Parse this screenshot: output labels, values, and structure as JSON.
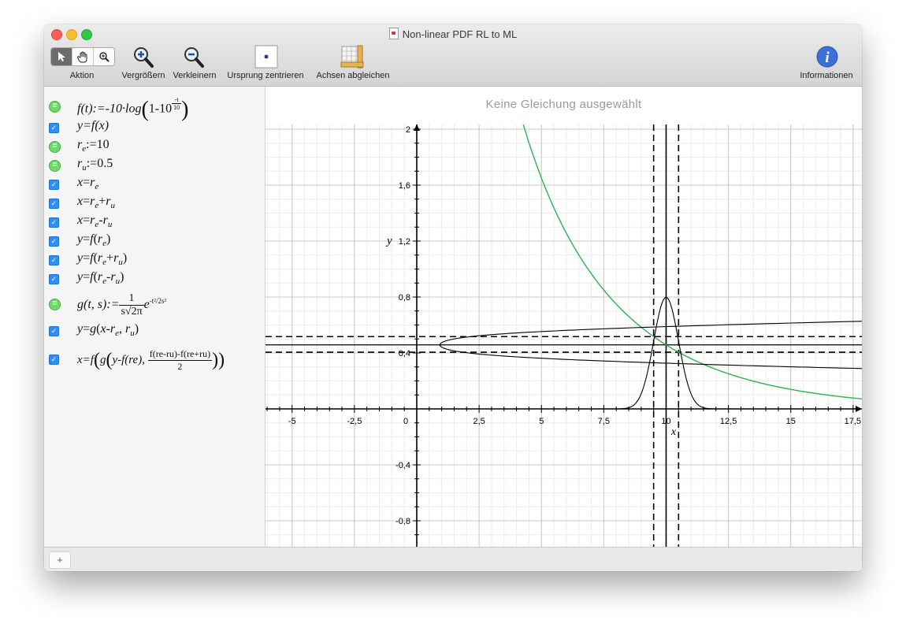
{
  "window": {
    "title": "Non-linear PDF RL to ML"
  },
  "toolbar": {
    "action_label": "Aktion",
    "zoom_in_label": "Vergrößern",
    "zoom_out_label": "Verkleinern",
    "center_origin_label": "Ursprung zentrieren",
    "equalize_axes_label": "Achsen abgleichen",
    "info_label": "Informationen",
    "action_tools": [
      "pointer-icon",
      "hand-icon",
      "magnifier-icon"
    ]
  },
  "equations": [
    {
      "kind": "definition",
      "text": "f(t):=-10·log(1-10^(-t/10))"
    },
    {
      "kind": "checked",
      "text": "y=f(x)"
    },
    {
      "kind": "definition",
      "text": "re:=10"
    },
    {
      "kind": "definition",
      "text": "ru:=0.5"
    },
    {
      "kind": "checked",
      "text": "x=re"
    },
    {
      "kind": "checked",
      "text": "x=re+ru"
    },
    {
      "kind": "checked",
      "text": "x=re-ru"
    },
    {
      "kind": "checked",
      "text": "y=f(re)"
    },
    {
      "kind": "checked",
      "text": "y=f(re+ru)"
    },
    {
      "kind": "checked",
      "text": "y=f(re-ru)"
    },
    {
      "kind": "definition",
      "text": "g(t, s):=1/(s√2π)·e^(-t²/2s²)"
    },
    {
      "kind": "checked",
      "text": "y=g(x-re, ru)"
    },
    {
      "kind": "checked",
      "text": "x=f(g(y-f(re), (f(re-ru)-f(re+ru))/2))"
    }
  ],
  "eq_parts": {
    "f_def": {
      "lhs": "f(t):=-10·log",
      "inner": "1-10",
      "exp_num": "-t",
      "exp_den": "10"
    },
    "yfx": "y=f(x)",
    "re_def": {
      "var": "r",
      "sub": "e",
      "rhs": ":=10"
    },
    "ru_def": {
      "var": "r",
      "sub": "u",
      "rhs": ":=0.5"
    },
    "g_def": {
      "lhs": "g(t, s):=",
      "num": "1",
      "den": "s√2π",
      "base": "e",
      "exp": "-t²/2s²"
    },
    "last": {
      "lhs": "x=f",
      "g": "g",
      "arg1": "y-f(re),",
      "num": "f(re-ru)-f(re+ru)",
      "den": "2"
    }
  },
  "graph": {
    "status": "Keine Gleichung ausgewählt",
    "x_axis_label": "x",
    "y_axis_label": "y",
    "x_ticks": [
      "-5",
      "-2,5",
      "0",
      "2,5",
      "5",
      "7,5",
      "10",
      "12,5",
      "15",
      "17,5"
    ],
    "y_ticks": [
      "2",
      "1,6",
      "1,2",
      "0,8",
      "0,4",
      "-0,4",
      "-0,8"
    ],
    "colors": {
      "curve_f": "#2fb24f",
      "curves": "#000000",
      "grid_major": "#c8c8c8",
      "grid_minor": "#ececec"
    }
  },
  "chart_data": {
    "type": "line",
    "title": "",
    "xlabel": "x",
    "ylabel": "y",
    "xlim": [
      -6,
      17.5
    ],
    "ylim": [
      -1,
      2
    ],
    "grid": true,
    "parameters": {
      "re": 10,
      "ru": 0.5
    },
    "series": [
      {
        "name": "y=f(x)",
        "expr": "-10*log10(1-10^(-x/10))",
        "color": "#2fb24f",
        "style": "solid"
      },
      {
        "name": "x=re",
        "x_value": 10,
        "style": "solid"
      },
      {
        "name": "x=re+ru",
        "x_value": 10.5,
        "style": "dashed"
      },
      {
        "name": "x=re-ru",
        "x_value": 9.5,
        "style": "dashed"
      },
      {
        "name": "y=f(re)",
        "y_value": 0.458,
        "style": "solid"
      },
      {
        "name": "y=f(re+ru)",
        "y_value": 0.412,
        "style": "dashed"
      },
      {
        "name": "y=f(re-ru)",
        "y_value": 0.52,
        "style": "dashed"
      },
      {
        "name": "y=g(x-re, ru)",
        "expr": "gaussian(x-10, 0.5)",
        "peak": 0.8,
        "style": "solid"
      },
      {
        "name": "x=f(g(y-f(re), (f(re-ru)-f(re+ru))/2))",
        "vertex": [
          1.0,
          0.458
        ],
        "style": "solid"
      }
    ]
  },
  "bottom": {
    "add_label": "+"
  }
}
